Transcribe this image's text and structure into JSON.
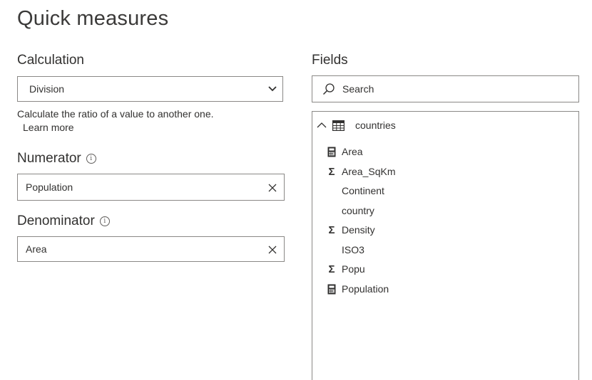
{
  "title": "Quick measures",
  "calculation": {
    "label": "Calculation",
    "selected": "Division",
    "description": "Calculate the ratio of a value to another one.",
    "learn_more": "Learn more"
  },
  "numerator": {
    "label": "Numerator",
    "value": "Population"
  },
  "denominator": {
    "label": "Denominator",
    "value": "Area"
  },
  "fields": {
    "label": "Fields",
    "search_placeholder": "Search",
    "table": {
      "name": "countries",
      "items": [
        {
          "label": "Area",
          "icon": "calculator-icon"
        },
        {
          "label": "Area_SqKm",
          "icon": "sigma-icon"
        },
        {
          "label": "Continent",
          "icon": ""
        },
        {
          "label": "country",
          "icon": ""
        },
        {
          "label": "Density",
          "icon": "sigma-icon"
        },
        {
          "label": "ISO3",
          "icon": ""
        },
        {
          "label": "Popu",
          "icon": "sigma-icon"
        },
        {
          "label": "Population",
          "icon": "calculator-icon"
        }
      ]
    }
  }
}
